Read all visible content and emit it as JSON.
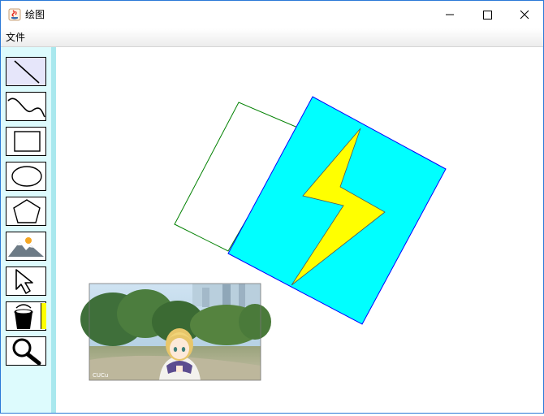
{
  "window": {
    "title": "绘图"
  },
  "menu": {
    "file": "文件"
  },
  "tools": [
    {
      "name": "line-tool",
      "icon": "line-icon"
    },
    {
      "name": "curve-tool",
      "icon": "curve-icon"
    },
    {
      "name": "rectangle-tool",
      "icon": "rectangle-icon"
    },
    {
      "name": "ellipse-tool",
      "icon": "ellipse-icon"
    },
    {
      "name": "polygon-tool",
      "icon": "pentagon-icon"
    },
    {
      "name": "image-tool",
      "icon": "mountain-image-icon"
    },
    {
      "name": "select-tool",
      "icon": "cursor-arrow-icon"
    },
    {
      "name": "fill-tool",
      "icon": "paint-bucket-icon"
    },
    {
      "name": "zoom-tool",
      "icon": "magnifier-icon"
    }
  ],
  "colors": {
    "accent_border": "#2b79d7",
    "toolbox_bg": "#ddfbfd",
    "current_fill": "#ffff00",
    "square_fill": "#00ffff",
    "rectangle_outline": "#008000",
    "square_outline": "#0000ff",
    "bolt_fill": "#ffff00"
  },
  "canvas": {
    "image_watermark": "CUCu"
  }
}
